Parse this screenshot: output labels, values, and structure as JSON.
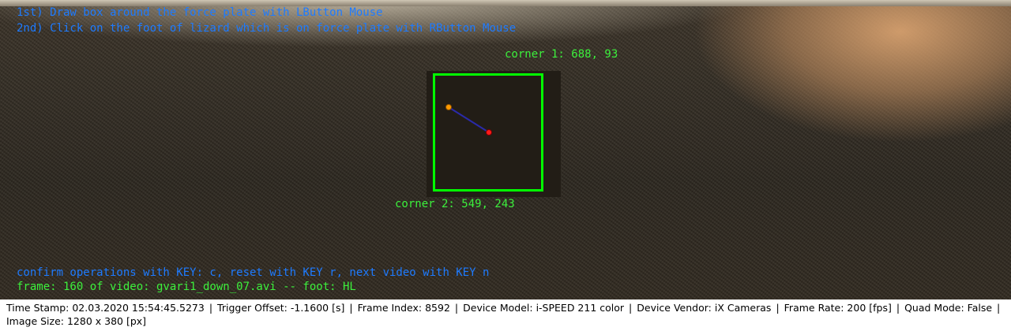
{
  "overlay": {
    "instruction_1": "1st) Draw box around the force plate with LButton Mouse",
    "instruction_2": "2nd) Click on the foot of lizard which is on force plate with RButton Mouse",
    "corner_1": "corner 1: 688, 93",
    "corner_2": "corner 2: 549, 243",
    "confirm": "confirm operations with KEY: c, reset with KEY r, next video with KEY n",
    "frame_info": "frame: 160 of video: gvari1_down_07.avi -- foot: HL"
  },
  "colors": {
    "box": "#00ff00",
    "instruction_text": "#1e7bff",
    "info_text": "#3cf03c",
    "marker_orange": "#ff9a00",
    "marker_red": "#ff1a1a",
    "marker_line": "#2a2aa8"
  },
  "status": {
    "time_stamp": "Time Stamp: 02.03.2020 15:54:45.5273",
    "trigger_offset": "Trigger Offset: -1.1600 [s]",
    "frame_index": "Frame Index: 8592",
    "device_model": "Device Model: i-SPEED 211 color",
    "device_vendor": "Device Vendor: iX Cameras",
    "frame_rate": "Frame Rate: 200 [fps]",
    "quad_mode": "Quad Mode: False",
    "image_size": "Image Size: 1280 x 380 [px]"
  }
}
